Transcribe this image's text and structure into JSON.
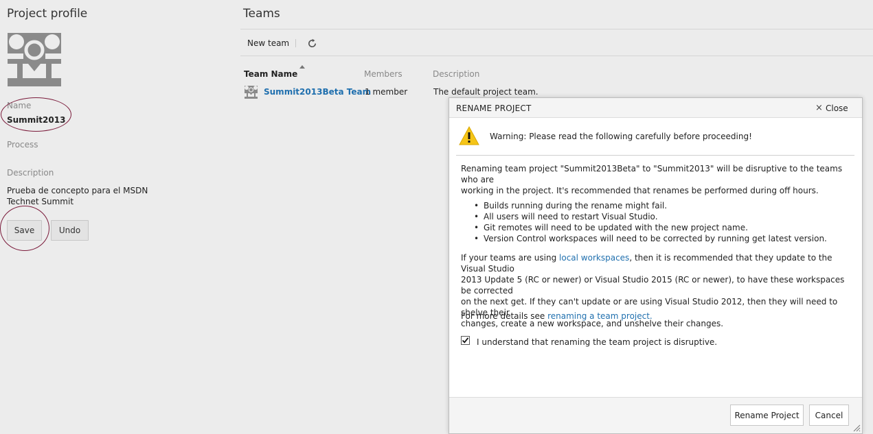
{
  "profile": {
    "title": "Project profile",
    "name_label": "Name",
    "name_value": "Summit2013",
    "process_label": "Process",
    "description_label": "Description",
    "description_value": "Prueba de concepto para el MSDN Technet Summit",
    "save_label": "Save",
    "undo_label": "Undo",
    "avatar_icon": "team-group-icon",
    "annotation_color": "#7a1a3a"
  },
  "teams": {
    "title": "Teams",
    "toolbar": {
      "new_team_label": "New team",
      "refresh_icon": "refresh-icon"
    },
    "columns": [
      "Team Name",
      "Members",
      "Description"
    ],
    "rows": [
      {
        "name": "Summit2013Beta Team",
        "members": "1 member",
        "description": "The default project team."
      }
    ],
    "link_color": "#1f6fae"
  },
  "dialog": {
    "title": "RENAME PROJECT",
    "close_label": "Close",
    "warning_text": "Warning: Please read the following carefully before proceeding!",
    "intro_line1": "Renaming team project \"Summit2013Beta\" to \"Summit2013\" will be disruptive to the teams who are",
    "intro_line2": "working in the project. It's recommended that renames be performed during off hours.",
    "bullets": [
      "Builds running during the rename might fail.",
      "All users will need to restart Visual Studio.",
      "Git remotes will need to be updated with the new project name.",
      "Version Control workspaces will need to be corrected by running get latest version."
    ],
    "workspaces_prefix": "If your teams are using ",
    "workspaces_link": "local workspaces",
    "workspaces_suffix": ", then it is recommended that they update to the Visual Studio",
    "workspaces_line2": "2013 Update 5 (RC or newer) or Visual Studio 2015 (RC or newer), to have these workspaces be corrected",
    "workspaces_line3": "on the next get. If they can't update or are using Visual Studio 2012, then they will need to shelve their",
    "workspaces_line4": "changes, create a new workspace, and unshelve their changes.",
    "details_prefix": "For more details see ",
    "details_link": "renaming a team project.",
    "checkbox_label": "I understand that renaming the team project is disruptive.",
    "checkbox_checked": true,
    "rename_button": "Rename Project",
    "cancel_button": "Cancel",
    "warning_color": "#f5c518"
  }
}
